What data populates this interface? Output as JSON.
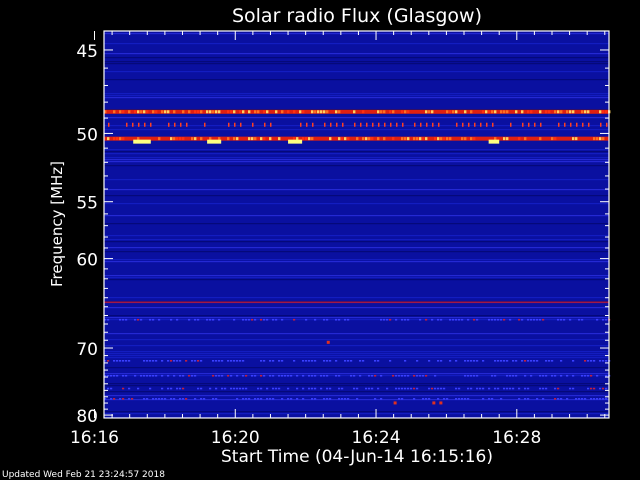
{
  "chart_data": {
    "type": "heatmap",
    "title": "Solar radio Flux (Glasgow)",
    "ylabel": "Frequency [MHz]",
    "xlabel": "Start Time (04-Jun-14 16:15:16)",
    "footer": "Updated Wed Feb 21 23:24:57 2018",
    "x_range_minutes": [
      16.27,
      30.62
    ],
    "x_ticks": [
      {
        "value": 16,
        "label": "16:16"
      },
      {
        "value": 20,
        "label": "16:20"
      },
      {
        "value": 24,
        "label": "16:24"
      },
      {
        "value": 28,
        "label": "16:28"
      }
    ],
    "y_range_mhz": [
      44.0,
      80.5
    ],
    "y_scale": "reciprocal",
    "y_ticks": [
      {
        "value": 45,
        "label": "45"
      },
      {
        "value": 50,
        "label": "50"
      },
      {
        "value": 55,
        "label": "55"
      },
      {
        "value": 60,
        "label": "60"
      },
      {
        "value": 70,
        "label": "70"
      },
      {
        "value": 80,
        "label": "80"
      }
    ],
    "colormap": "blue-red-yellow-white",
    "colors": {
      "background": "#0a10a0",
      "strong_band": "#e02010",
      "hot_spots": "#ffff80",
      "axis": "#ffffff"
    },
    "bands": [
      {
        "freq_mhz": 48.6,
        "level": 0.85,
        "note": "continuous strong emission line"
      },
      {
        "freq_mhz": 50.35,
        "level": 0.9,
        "note": "continuous strong emission line with bright patches"
      },
      {
        "freq_mhz": 64.5,
        "level": 0.5,
        "note": "moderate interference line"
      }
    ]
  }
}
